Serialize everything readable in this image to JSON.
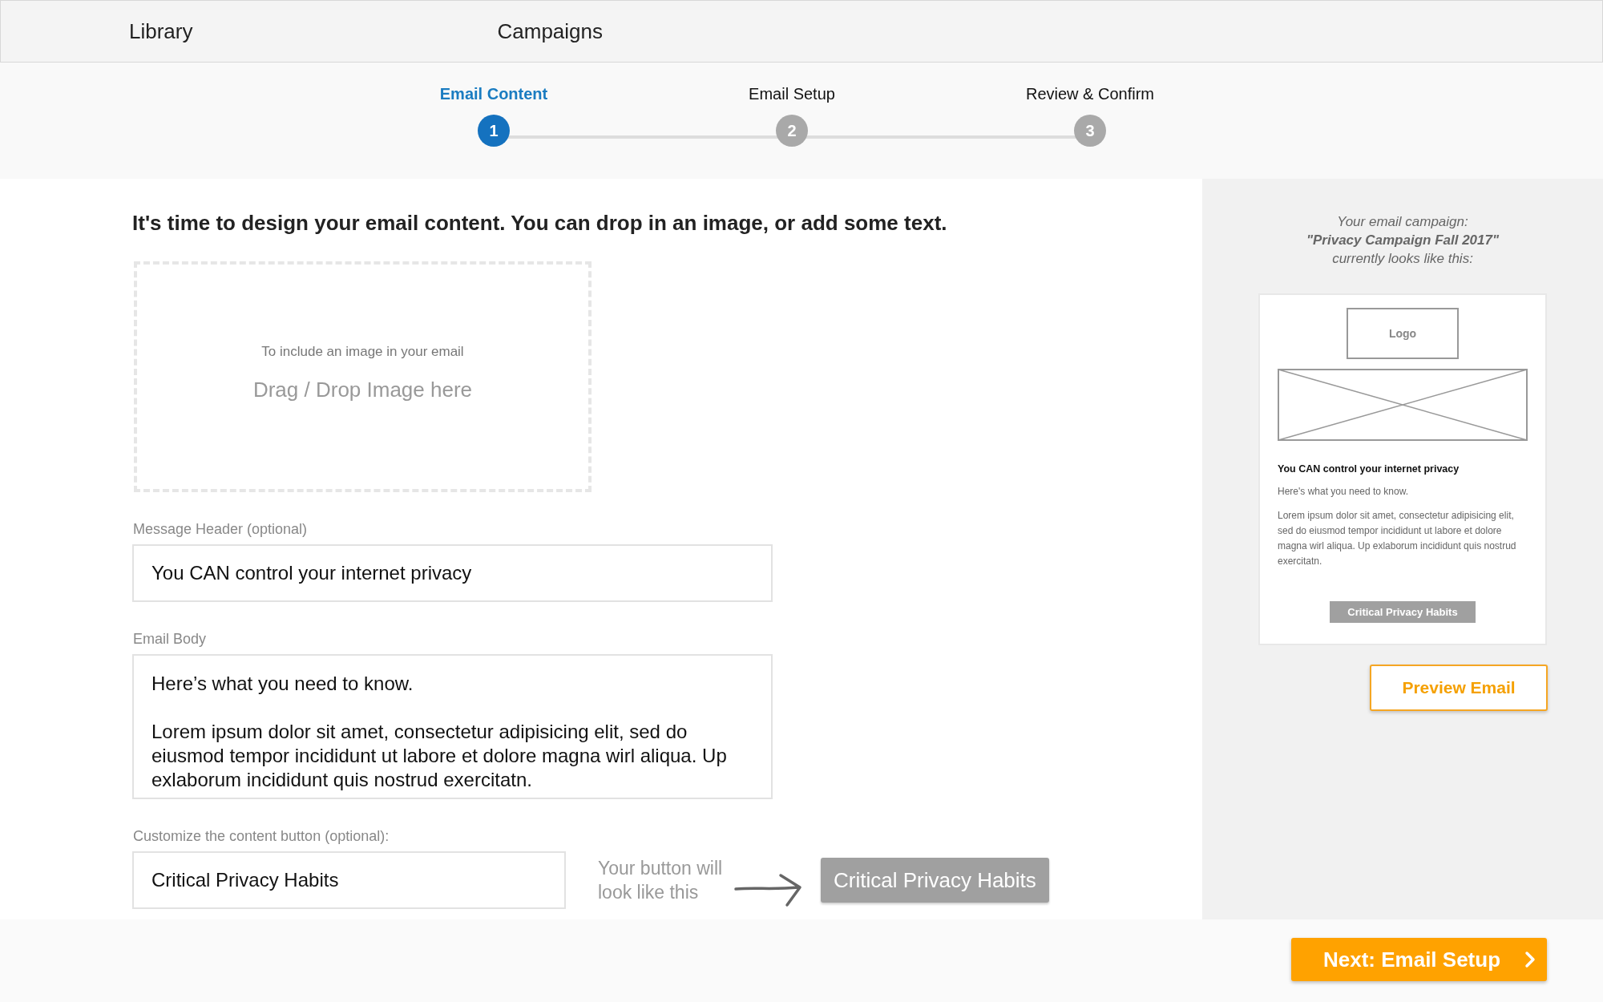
{
  "nav": {
    "items": [
      {
        "label": "Library"
      },
      {
        "label": "Campaigns"
      }
    ]
  },
  "steps": [
    {
      "label": "Email Content",
      "number": "1",
      "selected": true
    },
    {
      "label": "Email Setup",
      "number": "2",
      "selected": false
    },
    {
      "label": "Review & Confirm",
      "number": "3",
      "selected": false
    }
  ],
  "main": {
    "heading": "It's time to design your email content. You can drop in an image, or add some text.",
    "dropzone": {
      "hint": "To include an image in your email",
      "label": "Drag / Drop Image here"
    },
    "message_header": {
      "label": "Message Header (optional)",
      "value": "You CAN control your internet privacy"
    },
    "email_body": {
      "label": "Email Body",
      "value": [
        "Here’s what you need to know.",
        "Lorem ipsum dolor sit amet, consectetur adipisicing elit, sed do eiusmod tempor incididunt ut labore et dolore magna wirl aliqua. Up exlaborum incididunt quis nostrud exercitatn."
      ]
    },
    "content_button": {
      "label": "Customize the content button (optional):",
      "value": "Critical Privacy Habits",
      "hint": "Your button will look like this",
      "preview": "Critical Privacy Habits"
    }
  },
  "sidebar": {
    "caption": [
      "Your email campaign:",
      "\"Privacy Campaign Fall 2017\"",
      "currently looks like this:"
    ],
    "preview": {
      "logo": "Logo",
      "title": "You CAN control your internet privacy",
      "intro": "Here's what you need to know.",
      "body": "Lorem ipsum dolor sit amet, consectetur adipisicing elit, sed do eiusmod tempor incididunt ut labore et dolore magna wirl aliqua. Up exlaborum incididunt quis nostrud exercitatn.",
      "button": "Critical Privacy Habits"
    },
    "preview_button": "Preview Email"
  },
  "footer": {
    "next_button": "Next: Email Setup"
  }
}
